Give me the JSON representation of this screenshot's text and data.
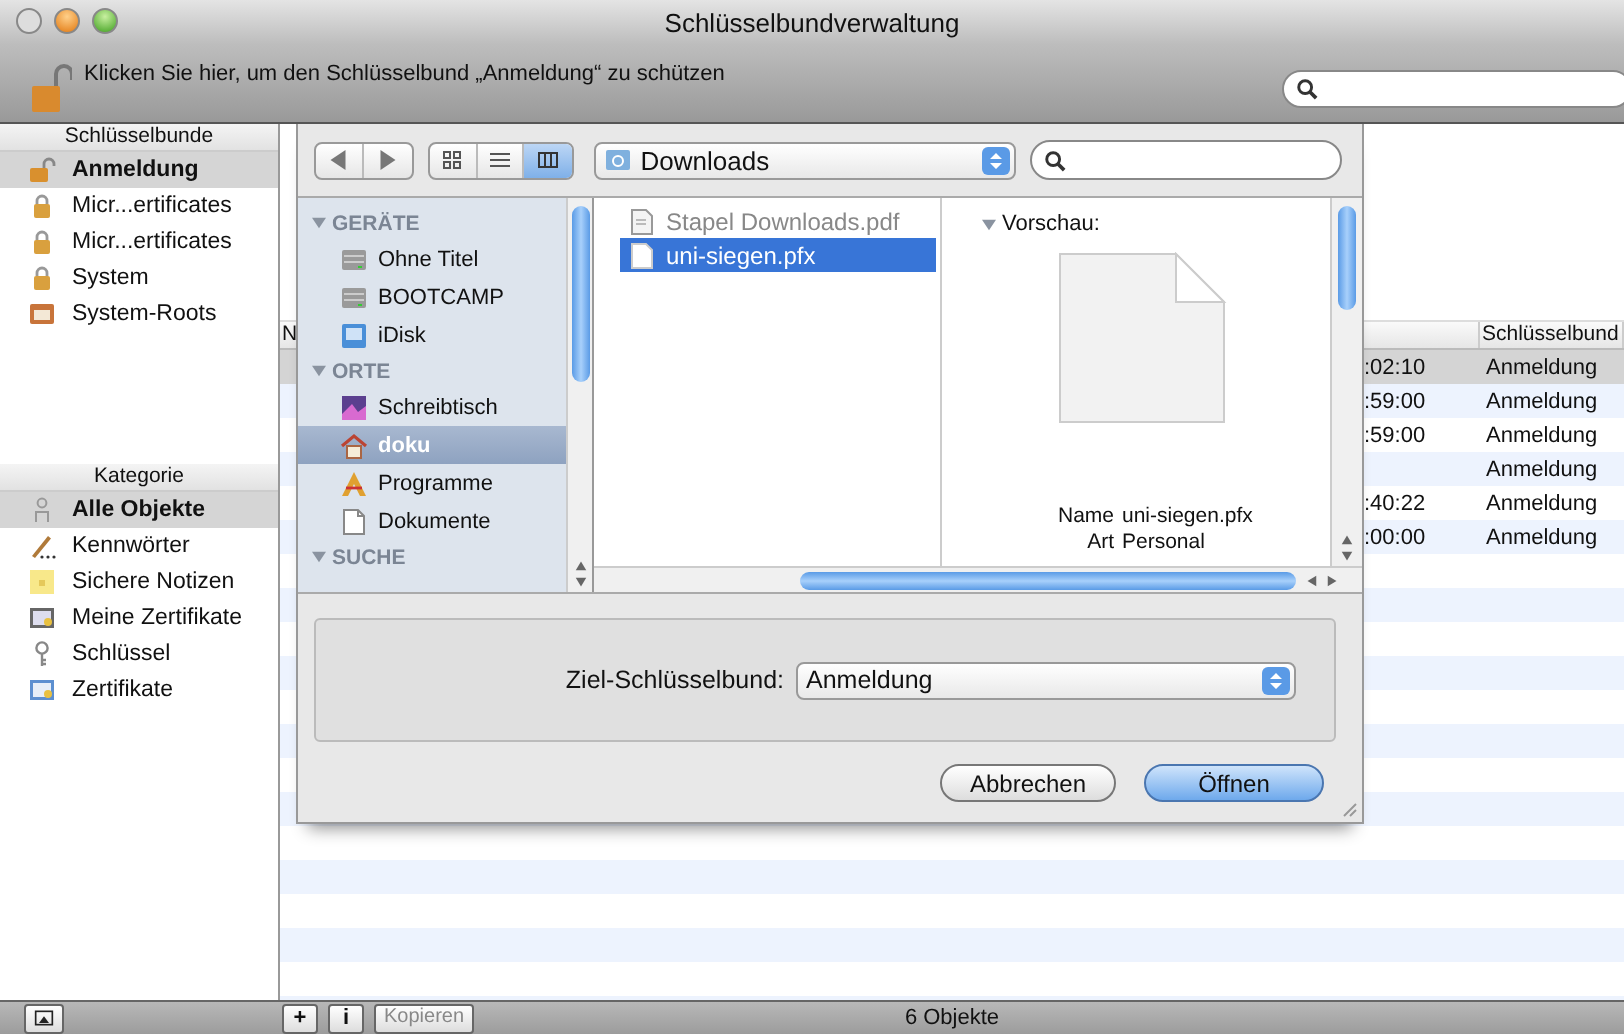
{
  "window": {
    "title": "Schlüsselbundverwaltung"
  },
  "toolbar": {
    "lock_message": "Klicken Sie hier, um den Schlüsselbund „Anmeldung“ zu schützen"
  },
  "sidebar": {
    "keychains_heading": "Schlüsselbunde",
    "keychains": [
      {
        "label": "Anmeldung",
        "kind": "lock-open",
        "selected": true
      },
      {
        "label": "Micr...ertificates",
        "kind": "lock",
        "selected": false
      },
      {
        "label": "Micr...ertificates",
        "kind": "lock",
        "selected": false
      },
      {
        "label": "System",
        "kind": "lock",
        "selected": false
      },
      {
        "label": "System-Roots",
        "kind": "cabinet",
        "selected": false
      }
    ],
    "categories_heading": "Kategorie",
    "categories": [
      {
        "label": "Alle Objekte",
        "kind": "people",
        "selected": true
      },
      {
        "label": "Kennwörter",
        "kind": "pen",
        "selected": false
      },
      {
        "label": "Sichere Notizen",
        "kind": "note",
        "selected": false
      },
      {
        "label": "Meine Zertifikate",
        "kind": "cert",
        "selected": false
      },
      {
        "label": "Schlüssel",
        "kind": "key",
        "selected": false
      },
      {
        "label": "Zertifikate",
        "kind": "cert-blue",
        "selected": false
      }
    ]
  },
  "table": {
    "columns": [
      {
        "label": "N"
      },
      {
        "label": "Schlüsselbund"
      }
    ],
    "rows": [
      {
        "time": ":02:10",
        "keychain": "Anmeldung",
        "selected": true
      },
      {
        "time": ":59:00",
        "keychain": "Anmeldung",
        "selected": false
      },
      {
        "time": ":59:00",
        "keychain": "Anmeldung",
        "selected": false
      },
      {
        "keychain": "Anmeldung",
        "selected": false
      },
      {
        "time": ":40:22",
        "keychain": "Anmeldung",
        "selected": false
      },
      {
        "time": ":00:00",
        "keychain": "Anmeldung",
        "selected": false
      }
    ]
  },
  "bottom_bar": {
    "buttons": [
      {
        "label": "+",
        "disabled": false
      },
      {
        "label": "i",
        "disabled": false
      },
      {
        "label": "Kopieren",
        "disabled": true
      }
    ],
    "status": "6 Objekte"
  },
  "dialog": {
    "view_modes": [
      {
        "kind": "icons",
        "selected": false
      },
      {
        "kind": "list",
        "selected": false
      },
      {
        "kind": "columns",
        "selected": true
      }
    ],
    "location": "Downloads",
    "sidebar": [
      {
        "title": "GERÄTE",
        "items": [
          {
            "label": "Ohne Titel",
            "kind": "disk",
            "selected": false
          },
          {
            "label": "BOOTCAMP",
            "kind": "disk",
            "selected": false
          },
          {
            "label": "iDisk",
            "kind": "idisk",
            "selected": false
          }
        ]
      },
      {
        "title": "ORTE",
        "items": [
          {
            "label": "Schreibtisch",
            "kind": "desktop",
            "selected": false
          },
          {
            "label": "doku",
            "kind": "home",
            "selected": true
          },
          {
            "label": "Programme",
            "kind": "apps",
            "selected": false
          },
          {
            "label": "Dokumente",
            "kind": "doc",
            "selected": false
          }
        ]
      },
      {
        "title": "SUCHE"
      }
    ],
    "files": [
      {
        "name": "Stapel Downloads.pdf",
        "kind": "pdf",
        "selected": false,
        "disabled": true
      },
      {
        "name": "uni-siegen.pfx",
        "kind": "file",
        "selected": true,
        "disabled": false
      }
    ],
    "preview": {
      "heading": "Vorschau:",
      "info": [
        {
          "label": "Name",
          "value": "uni-siegen.pfx"
        },
        {
          "label": "Art",
          "value": "Personal"
        }
      ]
    },
    "target": {
      "label": "Ziel-Schlüsselbund:",
      "value": "Anmeldung"
    },
    "buttons": [
      {
        "label": "Abbrechen",
        "kind": "normal"
      },
      {
        "label": "Öffnen",
        "kind": "default"
      }
    ]
  }
}
